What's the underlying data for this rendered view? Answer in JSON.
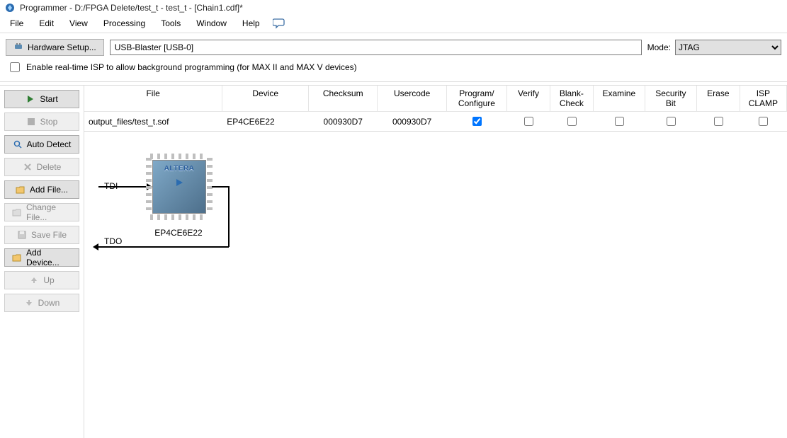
{
  "window": {
    "title": "Programmer - D:/FPGA Delete/test_t - test_t - [Chain1.cdf]*"
  },
  "menu": {
    "file": "File",
    "edit": "Edit",
    "view": "View",
    "processing": "Processing",
    "tools": "Tools",
    "window": "Window",
    "help": "Help"
  },
  "toolbar": {
    "hardware_setup": "Hardware Setup...",
    "hardware_value": "USB-Blaster [USB-0]",
    "mode_label": "Mode:",
    "mode_value": "JTAG"
  },
  "option": {
    "realtime_isp": "Enable real-time ISP to allow background programming (for MAX II and MAX V devices)"
  },
  "sidebar": {
    "start": "Start",
    "stop": "Stop",
    "auto_detect": "Auto Detect",
    "delete": "Delete",
    "add_file": "Add File...",
    "change_file": "Change File...",
    "save_file": "Save File",
    "add_device": "Add Device...",
    "up": "Up",
    "down": "Down"
  },
  "table": {
    "headers": {
      "file": "File",
      "device": "Device",
      "checksum": "Checksum",
      "usercode": "Usercode",
      "program": "Program/\nConfigure",
      "verify": "Verify",
      "blank": "Blank-\nCheck",
      "examine": "Examine",
      "security": "Security\nBit",
      "erase": "Erase",
      "isp": "ISP\nCLAMP"
    },
    "rows": [
      {
        "file": "output_files/test_t.sof",
        "device": "EP4CE6E22",
        "checksum": "000930D7",
        "usercode": "000930D7",
        "program": true,
        "verify": false,
        "blank": false,
        "examine": false,
        "security": false,
        "erase": false,
        "isp": false
      }
    ]
  },
  "chain": {
    "tdi": "TDI",
    "tdo": "TDO",
    "chip_brand": "ALTERA",
    "chip_label": "EP4CE6E22"
  }
}
